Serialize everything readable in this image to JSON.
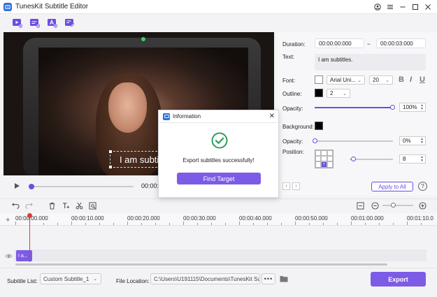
{
  "window": {
    "title": "TunesKit Subtitle Editor",
    "controls": [
      "account-icon",
      "menu-icon",
      "minimize-icon",
      "maximize-icon",
      "close-icon"
    ]
  },
  "toolbar": {
    "items": [
      "add-video-icon",
      "add-subtitle-icon",
      "add-text-icon",
      "edit-subtitle-icon"
    ]
  },
  "preview": {
    "subtitle_text": "I am subtitle",
    "current_time": "00:00:"
  },
  "properties": {
    "duration_label": "Duration:",
    "duration_start": "00:00:00:000",
    "duration_sep": "~",
    "duration_end": "00:00:03:000",
    "text_label": "Text:",
    "text_value": "I am subtitles.",
    "font_label": "Font:",
    "font_name": "Arial Uni...",
    "font_size": "20",
    "bold": "B",
    "italic": "I",
    "underline": "U",
    "outline_label": "Outline:",
    "outline_value": "2",
    "opacity_label": "Opacity:",
    "opacity_value": "100%",
    "background_label": "Background:",
    "bg_opacity_label": "Opacity:",
    "bg_opacity_value": "0%",
    "position_label": "Position:",
    "position_value": "8",
    "position_marker": "T",
    "apply_all": "Apply to All",
    "help": "?",
    "text_opacity_level": 1.0,
    "bg_opacity_level": 0.0,
    "position_level": 0.08
  },
  "timeline": {
    "ticks": [
      "00:00:00.000",
      "00:00:10.000",
      "00:00:20.000",
      "00:00:30.000",
      "00:00:40.000",
      "00:00:50.000",
      "00:01:00.000",
      "00:01:10.0"
    ],
    "clip_label": "I a..."
  },
  "footer": {
    "subtitle_list_label": "Subtitle List:",
    "subtitle_list_value": "Custom Subtitle_1",
    "file_location_label": "File Location:",
    "file_location_value": "C:\\Users\\U191115\\Documents\\TunesKit Sul",
    "browse": "•••",
    "export": "Export"
  },
  "dialog": {
    "title": "Information",
    "message": "Export subtitles successfully!",
    "button": "Find Target"
  },
  "colors": {
    "accent": "#7c5ce6",
    "brand": "#2d6fe0",
    "success": "#2e9e5b",
    "playhead": "#e03a3a"
  }
}
